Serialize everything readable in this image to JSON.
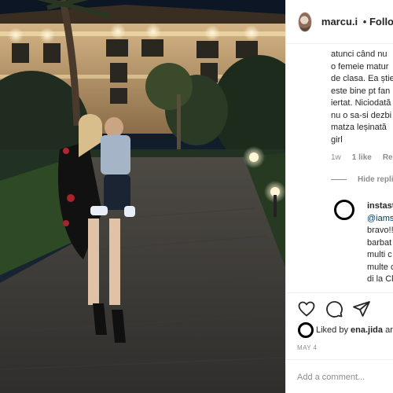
{
  "post": {
    "username": "marcu.i",
    "separator": "•",
    "follow_label": "Follo"
  },
  "caption_lines": [
    "atunci când nu",
    "o femeie matur",
    "de clasa. Ea știe",
    "este bine pt fan",
    "iertat. Niciodată",
    "nu o sa-si dezbi",
    "matza leșinată",
    "girl"
  ],
  "comment_meta": {
    "time": "1w",
    "likes": "1 like",
    "reply": "Reply"
  },
  "hide_replies": "Hide replie",
  "reply": {
    "username": "instast",
    "lines": [
      "@iamsı",
      "bravo!!",
      "barbat",
      "multi c",
      "multe c",
      "di la Cl"
    ]
  },
  "likes": {
    "prefix": "Liked by",
    "user": "ena.jida",
    "suffix": "ar"
  },
  "date": "MAY 4",
  "comment": {
    "placeholder": "Add a comment..."
  },
  "icons": [
    "heart-icon",
    "comment-icon",
    "share-icon"
  ],
  "colors": {
    "text": "#262626",
    "muted": "#8e8e8e",
    "border": "#efefef",
    "link": "#00376b"
  }
}
